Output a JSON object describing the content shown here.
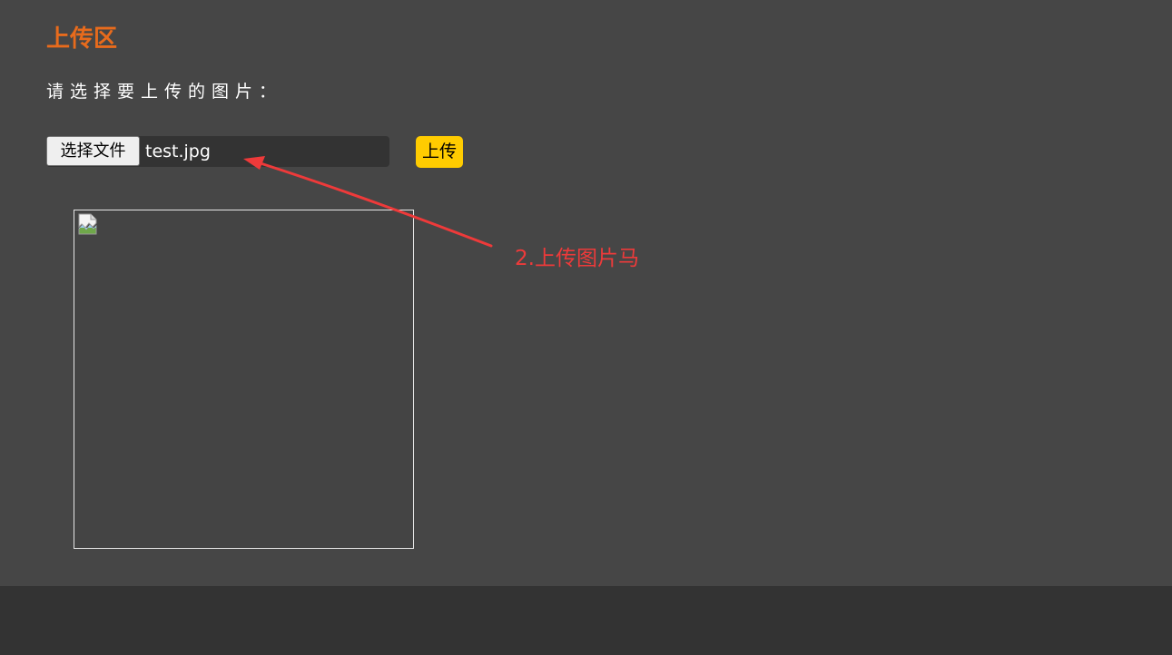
{
  "header": {
    "title": "上传区"
  },
  "form": {
    "prompt": "请选择要上传的图片：",
    "choose_file_label": "选择文件",
    "selected_file": "test.jpg",
    "upload_label": "上传"
  },
  "preview": {
    "icon": "broken-image-icon"
  },
  "annotation": {
    "text": "2.上传图片马",
    "color": "#ee3a3a"
  },
  "colors": {
    "title": "#e86b1c",
    "upload_button": "#ffcc00",
    "background": "#464646",
    "footer": "#333333"
  }
}
